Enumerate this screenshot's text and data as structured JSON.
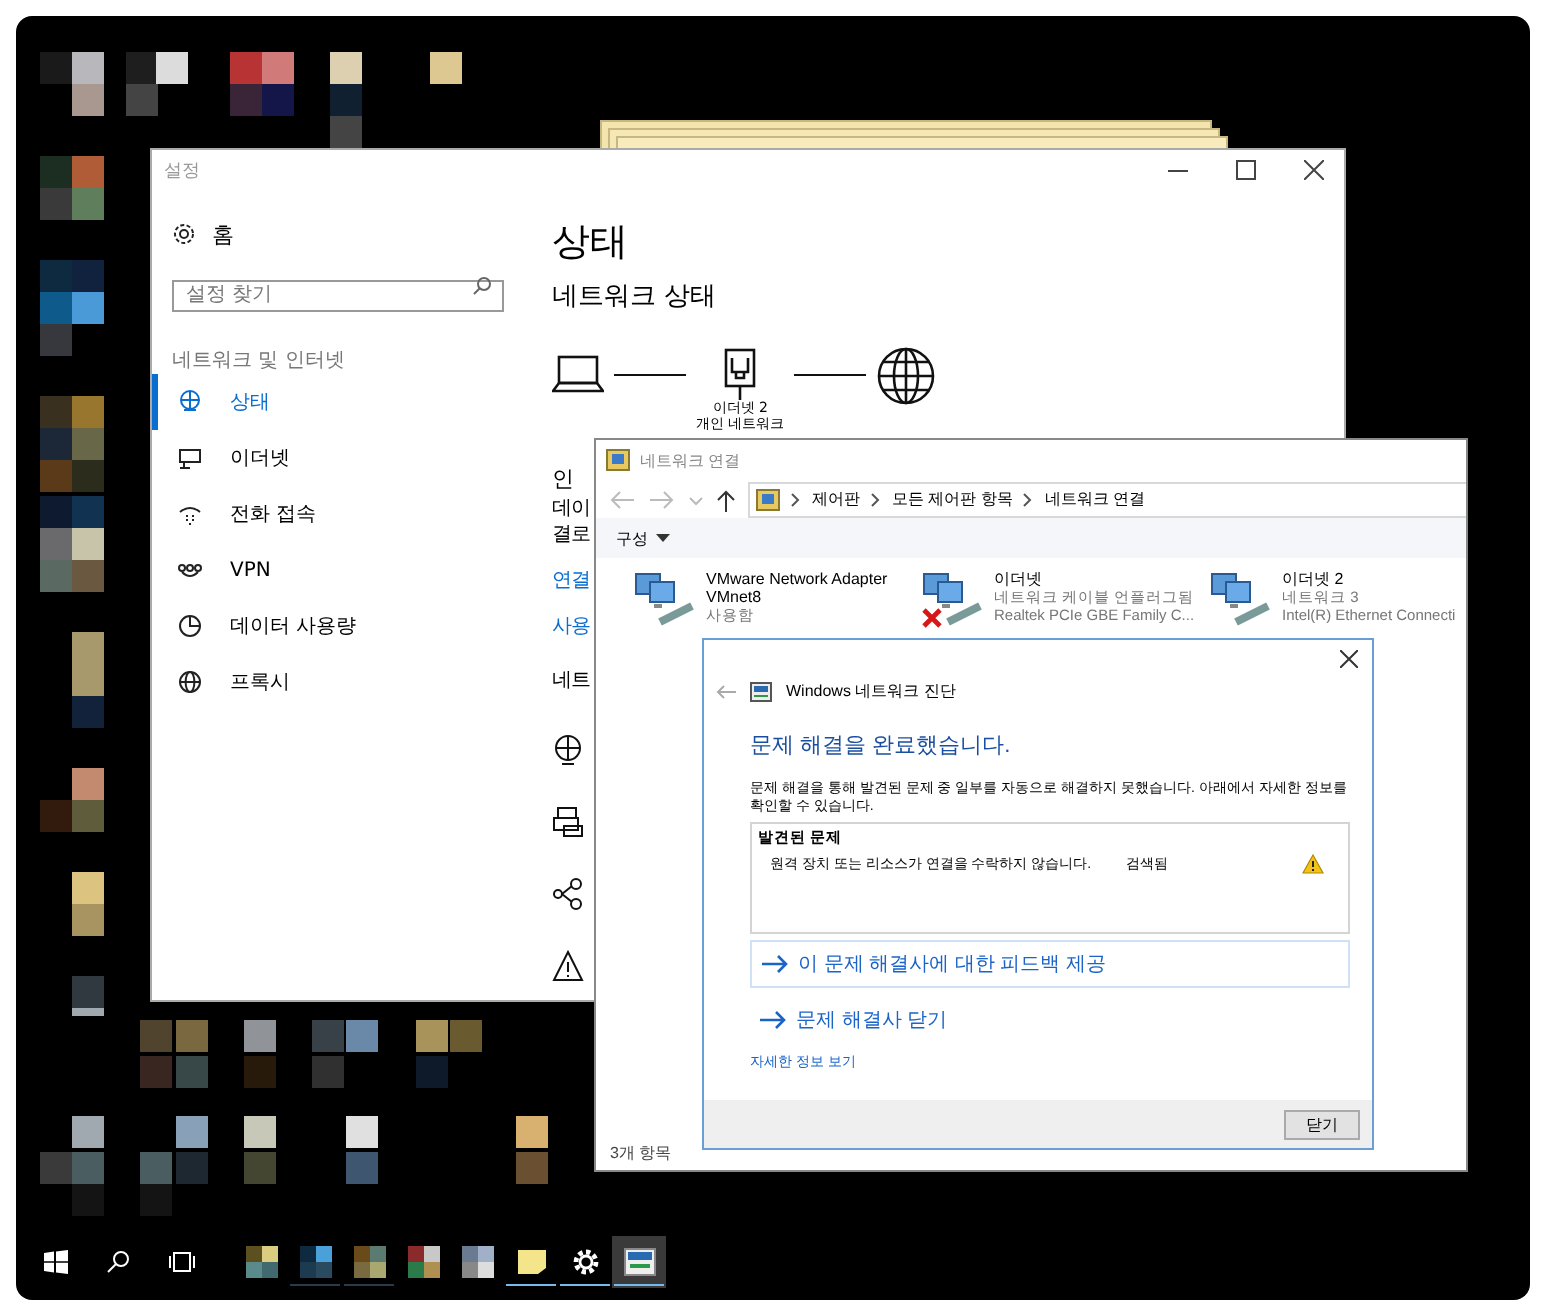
{
  "settings_window": {
    "title": "설정",
    "home": "홈",
    "search": {
      "placeholder": "설정 찾기"
    },
    "category": "네트워크 및 인터넷",
    "nav": [
      {
        "label": "상태",
        "selected": true
      },
      {
        "label": "이더넷",
        "selected": false
      },
      {
        "label": "전화 접속",
        "selected": false
      },
      {
        "label": "VPN",
        "selected": false
      },
      {
        "label": "데이터 사용량",
        "selected": false
      },
      {
        "label": "프록시",
        "selected": false
      }
    ],
    "page_title": "상태",
    "section_title": "네트워크 상태",
    "diagram": {
      "adapter": "이더넷 2",
      "network": "개인 네트워크"
    },
    "partial_lines": [
      "인",
      "데이",
      "결로"
    ],
    "links": [
      "연결",
      "사용"
    ],
    "partial_heading": "네트"
  },
  "network_window": {
    "title": "네트워크 연결",
    "breadcrumb": [
      "제어판",
      "모든 제어판 항목",
      "네트워크 연결"
    ],
    "toolbar_menu": "구성",
    "adapters": [
      {
        "name": "VMware Network Adapter VMnet8",
        "status": "사용함",
        "disconnected": false
      },
      {
        "name": "이더넷",
        "status": "네트워크 케이블 언플러그됨",
        "device": "Realtek PCIe GBE Family C...",
        "disconnected": true
      },
      {
        "name": "이더넷 2",
        "status": "네트워크  3",
        "device": "Intel(R) Ethernet Connecti",
        "disconnected": false
      }
    ],
    "status_bar": "3개 항목"
  },
  "dialog": {
    "title": "Windows 네트워크 진단",
    "heading": "문제 해결을 완료했습니다.",
    "message": "문제 해결을 통해 발견된 문제 중 일부를 자동으로 해결하지 못했습니다. 아래에서 자세한 정보를 확인할 수 있습니다.",
    "problems_header": "발견된 문제",
    "problems": [
      {
        "text": "원격 장치 또는 리소스가 연결을 수락하지 않습니다.",
        "status": "검색됨"
      }
    ],
    "actions": [
      "이 문제 해결사에 대한 피드백 제공",
      "문제 해결사 닫기"
    ],
    "details_link": "자세한 정보 보기",
    "close_button": "닫기"
  },
  "taskbar": {
    "apps": [
      {
        "running": false,
        "selected": false
      },
      {
        "running": true,
        "selected": false
      },
      {
        "running": true,
        "selected": false
      },
      {
        "running": false,
        "selected": false
      },
      {
        "running": false,
        "selected": false
      },
      {
        "running": true,
        "selected": false
      },
      {
        "running": true,
        "selected": false
      },
      {
        "running": true,
        "selected": true
      }
    ]
  }
}
